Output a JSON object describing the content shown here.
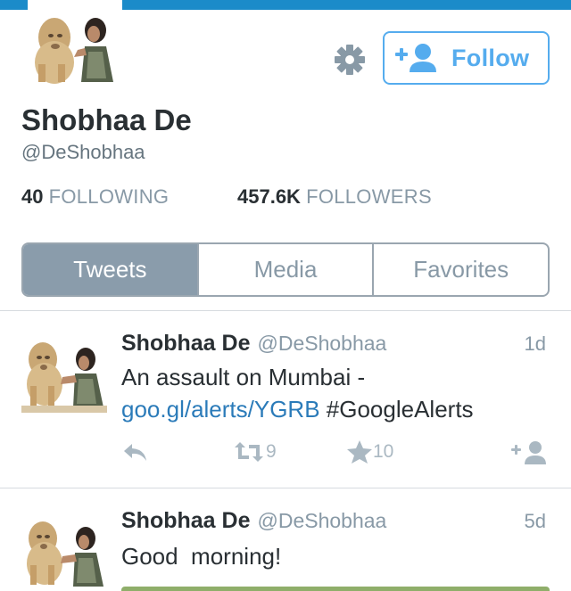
{
  "profile": {
    "display_name": "Shobhaa De",
    "handle": "@DeShobhaa",
    "following_count": "40",
    "following_label": "FOLLOWING",
    "followers_count": "457.6K",
    "followers_label": "FOLLOWERS"
  },
  "header": {
    "settings_icon": "gear-icon",
    "follow_label": "Follow",
    "follow_icon": "add-user-icon",
    "accent_color": "#55acee",
    "top_bar_color": "#1b8bc9"
  },
  "tabs": [
    {
      "label": "Tweets",
      "active": true
    },
    {
      "label": "Media",
      "active": false
    },
    {
      "label": "Favorites",
      "active": false
    }
  ],
  "tweets": [
    {
      "name": "Shobhaa De",
      "handle": "@DeShobhaa",
      "time": "1d",
      "text_prefix": "An assault on Mumbai - ",
      "link": "goo.gl/alerts/YGRB",
      "text_suffix": " #GoogleAlerts",
      "retweets": "9",
      "favorites": "10"
    },
    {
      "name": "Shobhaa De",
      "handle": "@DeShobhaa",
      "time": "5d",
      "text": "Good  morning!"
    }
  ]
}
